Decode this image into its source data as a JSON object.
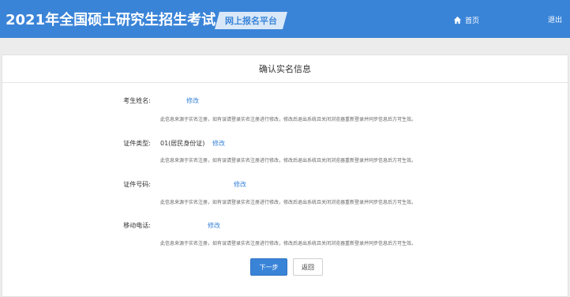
{
  "header": {
    "site_title": "2021年全国硕士研究生招生考试",
    "platform_tag": "网上报名平台",
    "nav_home": "首页",
    "nav_logout": "退出"
  },
  "card": {
    "title": "确认实名信息"
  },
  "fields": [
    {
      "label": "考生姓名:",
      "value": "",
      "edit_label": "修改",
      "note": "此信息来源于实名注册，如有误请登录实名注册进行修改，修改后退出系统且关闭浏览器重新登录并同步信息后方可生效。"
    },
    {
      "label": "证件类型:",
      "value": "01(居民身份证)",
      "edit_label": "修改",
      "note": "此信息来源于实名注册，如有误请登录实名注册进行修改，修改后退出系统且关闭浏览器重新登录并同步信息后方可生效。"
    },
    {
      "label": "证件号码:",
      "value": "",
      "edit_label": "修改",
      "note": "此信息来源于实名注册，如有误请登录实名注册进行修改，修改后退出系统且关闭浏览器重新登录并同步信息后方可生效。"
    },
    {
      "label": "移动电话:",
      "value": "",
      "edit_label": "修改",
      "note": "此信息来源于实名注册，如有误请登录实名注册进行修改，修改后退出系统且关闭浏览器重新登录并同步信息后方可生效。"
    }
  ],
  "actions": {
    "next_label": "下一步",
    "back_label": "返回"
  },
  "colors": {
    "header_bg": "#3a84d8",
    "accent": "#3a84d8",
    "page_bg": "#ececec"
  }
}
